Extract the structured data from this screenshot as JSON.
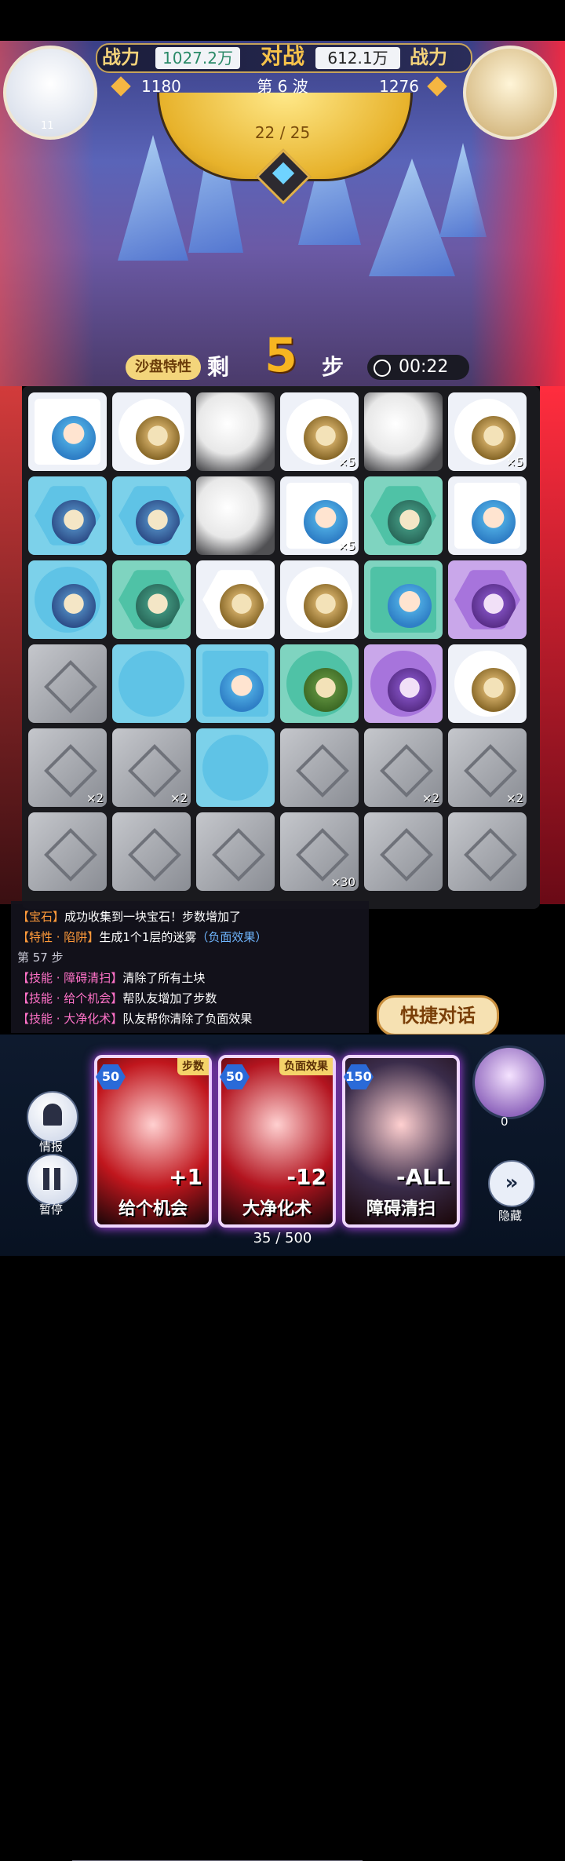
{
  "header": {
    "left_power_label": "战力",
    "left_power_value": "1027.2万",
    "vs_label": "对战",
    "right_power_value": "612.1万",
    "right_power_label": "战力",
    "left_gold": "1180",
    "right_gold": "1276",
    "wave_label": "第 6 波",
    "wave_progress": "22 / 25",
    "left_avatar_level": "11"
  },
  "turn": {
    "trait_label": "沙盘特性",
    "remain_label": "剩",
    "steps_left": "5",
    "step_char": "步",
    "timer": "00:22"
  },
  "board": {
    "rows": 6,
    "cols": 6,
    "cells": [
      [
        {
          "bg": "white",
          "token": "square",
          "face": "girl",
          "mult": ""
        },
        {
          "bg": "white",
          "token": "circle",
          "face": "beast",
          "mult": ""
        },
        {
          "bg": "fog",
          "mult": ""
        },
        {
          "bg": "white",
          "token": "circle",
          "face": "beast",
          "mult": "×5"
        },
        {
          "bg": "fog",
          "mult": ""
        },
        {
          "bg": "white",
          "token": "circle",
          "face": "beast",
          "mult": "×5"
        }
      ],
      [
        {
          "bg": "cyan",
          "token": "hex",
          "face": "dragon",
          "mult": ""
        },
        {
          "bg": "cyan",
          "token": "hex",
          "face": "dragon",
          "mult": ""
        },
        {
          "bg": "fog",
          "mult": ""
        },
        {
          "bg": "white",
          "token": "square",
          "face": "girl",
          "mult": "×5"
        },
        {
          "bg": "teal",
          "token": "hex",
          "face": "teal",
          "mult": ""
        },
        {
          "bg": "white",
          "token": "square",
          "face": "girl",
          "mult": ""
        }
      ],
      [
        {
          "bg": "cyan",
          "token": "circle",
          "face": "dragon",
          "mult": ""
        },
        {
          "bg": "teal",
          "token": "hex",
          "face": "teal",
          "mult": ""
        },
        {
          "bg": "white",
          "token": "hex",
          "face": "beast",
          "mult": ""
        },
        {
          "bg": "white",
          "token": "circle",
          "face": "beast",
          "mult": ""
        },
        {
          "bg": "teal",
          "token": "square",
          "face": "girl",
          "mult": ""
        },
        {
          "bg": "purple",
          "token": "hex",
          "face": "purple",
          "mult": ""
        }
      ],
      [
        {
          "bg": "stone",
          "mult": ""
        },
        {
          "bg": "cyan",
          "token": "circle",
          "face": "",
          "mult": ""
        },
        {
          "bg": "cyan",
          "token": "square",
          "face": "girl",
          "mult": ""
        },
        {
          "bg": "teal",
          "token": "circle",
          "face": "green",
          "mult": ""
        },
        {
          "bg": "purple",
          "token": "circle",
          "face": "purple",
          "mult": ""
        },
        {
          "bg": "white",
          "token": "circle",
          "face": "beast",
          "mult": ""
        }
      ],
      [
        {
          "bg": "stone",
          "mult": "×2"
        },
        {
          "bg": "stone",
          "mult": "×2"
        },
        {
          "bg": "cyan",
          "token": "circle",
          "face": "",
          "mult": ""
        },
        {
          "bg": "stone",
          "mult": ""
        },
        {
          "bg": "stone",
          "mult": "×2"
        },
        {
          "bg": "stone",
          "mult": "×2"
        }
      ],
      [
        {
          "bg": "stone",
          "mult": ""
        },
        {
          "bg": "stone",
          "mult": ""
        },
        {
          "bg": "stone",
          "mult": ""
        },
        {
          "bg": "stone",
          "mult": "×30"
        },
        {
          "bg": "stone",
          "mult": ""
        },
        {
          "bg": "stone",
          "mult": ""
        }
      ]
    ]
  },
  "log": {
    "line1_tag": "【宝石】",
    "line1_text": "成功收集到一块宝石！步数增加了",
    "line2_tag": "【特性 · 陷阱】",
    "line2_text": "生成1个1层的迷雾",
    "line2_link": "（负面效果）",
    "step_label": "第 57 步",
    "line3_tag": "【技能 · 障碍清扫】",
    "line3_text": "清除了所有土块",
    "line4_tag": "【技能 · 给个机会】",
    "line4_text": "帮队友增加了步数",
    "line5_tag": "【技能 · 大净化术】",
    "line5_text": "队友帮你清除了负面效果"
  },
  "quick_chat": "快捷对话",
  "controls": {
    "report_label": "情报",
    "pause_label": "暂停",
    "hide_label": "隐藏",
    "ally_count": "0"
  },
  "cards": [
    {
      "cost": "50",
      "tag": "步数",
      "value": "+1",
      "name": "给个机会",
      "color": "#c0161d"
    },
    {
      "cost": "50",
      "tag": "负面效果",
      "value": "-12",
      "name": "大净化术",
      "color": "#b3141f"
    },
    {
      "cost": "150",
      "tag": "",
      "value": "-ALL",
      "name": "障碍清扫",
      "color": "#3a2c4a"
    }
  ],
  "energy": "35 / 500",
  "colors": {
    "gold": "#f3d27a",
    "accent_red": "#ff2d3e",
    "card_glow": "#c04bff"
  }
}
